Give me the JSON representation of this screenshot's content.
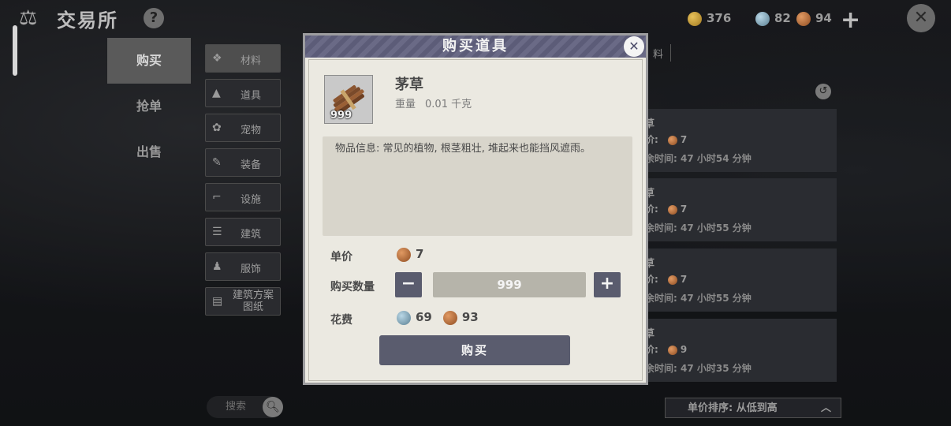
{
  "header": {
    "title": "交易所",
    "help": "?",
    "currencies": [
      {
        "type": "gold",
        "value": "376"
      },
      {
        "type": "silver",
        "value": "82"
      },
      {
        "type": "copper",
        "value": "94"
      }
    ],
    "add_icon": "+",
    "close_icon": "✕"
  },
  "left_menu": [
    {
      "label": "购买",
      "active": true
    },
    {
      "label": "抢单",
      "active": false
    },
    {
      "label": "出售",
      "active": false
    }
  ],
  "categories": [
    {
      "label": "材料",
      "icon": "material-icon"
    },
    {
      "label": "道具",
      "icon": "tool-icon"
    },
    {
      "label": "宠物",
      "icon": "paw-icon"
    },
    {
      "label": "装备",
      "icon": "equipment-icon"
    },
    {
      "label": "设施",
      "icon": "facility-icon"
    },
    {
      "label": "建筑",
      "icon": "building-icon"
    },
    {
      "label": "服饰",
      "icon": "clothing-icon"
    },
    {
      "label": "建筑方案图纸",
      "icon": "blueprint-icon"
    }
  ],
  "search": {
    "placeholder": "搜索"
  },
  "right_panel": {
    "tab_label": "料",
    "listings": [
      {
        "name": "茅草",
        "price_label": "价:",
        "price": "7",
        "time": "余时间: 47 小时54 分钟"
      },
      {
        "name": "茅草",
        "price_label": "价:",
        "price": "7",
        "time": "余时间: 47 小时55 分钟"
      },
      {
        "name": "茅草",
        "price_label": "价:",
        "price": "7",
        "time": "余时间: 47 小时55 分钟"
      },
      {
        "name": "茅草",
        "price_label": "价:",
        "price": "9",
        "time": "余时间: 47 小时35 分钟"
      }
    ],
    "listing_name_visible": "茅草",
    "sort_label": "单价排序: 从低到高"
  },
  "modal": {
    "title": "购买道具",
    "item_name": "茅草",
    "item_count": "999",
    "weight_label": "重量",
    "weight_value": "0.01 千克",
    "description": "物品信息: 常见的植物, 根茎粗壮, 堆起来也能挡风遮雨。",
    "unit_price_label": "单价",
    "unit_price": "7",
    "quantity_label": "购买数量",
    "quantity": "999",
    "minus": "−",
    "plus": "+",
    "cost_label": "花费",
    "cost_silver": "69",
    "cost_copper": "93",
    "buy_label": "购买"
  },
  "colors": {
    "modal_bg": "#ebe9e1",
    "modal_header": "#5c5c78",
    "button": "#5a5c6e",
    "qty_field": "#b6b4aa"
  }
}
